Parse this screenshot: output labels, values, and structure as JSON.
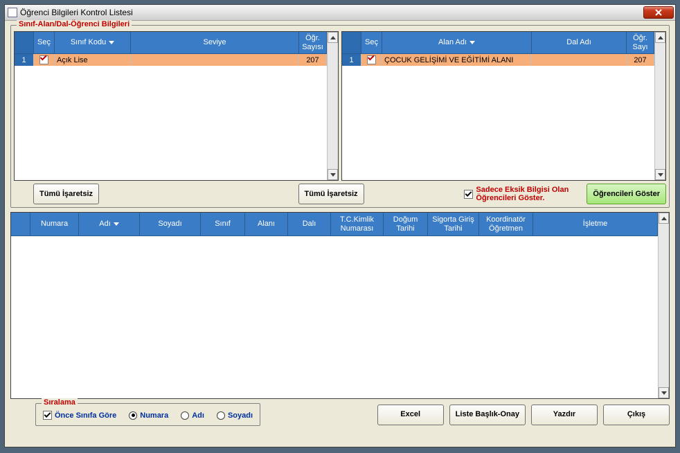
{
  "window": {
    "title": "Öğrenci Bilgileri Kontrol Listesi"
  },
  "group_top_label": "Sınıf-Alan/Dal-Öğrenci Bilgileri",
  "left_grid": {
    "headers": {
      "rn": "",
      "sec": "Seç",
      "kodu": "Sınıf Kodu",
      "seviye": "Seviye",
      "sayi": "Öğr. Sayısı"
    },
    "rows": [
      {
        "rn": "1",
        "checked": true,
        "kodu": "Açık Lise",
        "seviye": "",
        "sayi": "207"
      }
    ]
  },
  "right_grid": {
    "headers": {
      "rn": "",
      "sec": "Seç",
      "alan": "Alan Adı",
      "dal": "Dal Adı",
      "sayi": "Öğr. Sayı"
    },
    "rows": [
      {
        "rn": "1",
        "checked": true,
        "alan": "ÇOCUK GELİŞİMİ VE EĞİTİMİ ALANI",
        "dal": "",
        "sayi": "207"
      }
    ]
  },
  "buttons": {
    "tumu_isaretsiz": "Tümü İşaretsiz",
    "filter_checkbox_label": "Sadece Eksik Bilgisi Olan Öğrencileri Göster.",
    "ogrencileri_goster": "Öğrencileri Göster",
    "excel": "Excel",
    "liste_baslik_onay": "Liste Başlık-Onay",
    "yazdir": "Yazdır",
    "cikis": "Çıkış"
  },
  "filter_checked": true,
  "main_grid": {
    "headers": {
      "numara": "Numara",
      "adi": "Adı",
      "soyadi": "Soyadı",
      "sinif": "Sınıf",
      "alani": "Alanı",
      "dali": "Dalı",
      "tc": "T.C.Kimlik Numarası",
      "dogum": "Doğum Tarihi",
      "sigorta": "Sigorta Giriş Tarihi",
      "koordinator": "Koordinatör Öğretmen",
      "isletme": "İşletme"
    }
  },
  "sort": {
    "label": "Sıralama",
    "once_sinifa": "Önce Sınıfa Göre",
    "numara": "Numara",
    "adi": "Adı",
    "soyadi": "Soyadı",
    "once_sinifa_checked": true,
    "selected": "numara"
  }
}
